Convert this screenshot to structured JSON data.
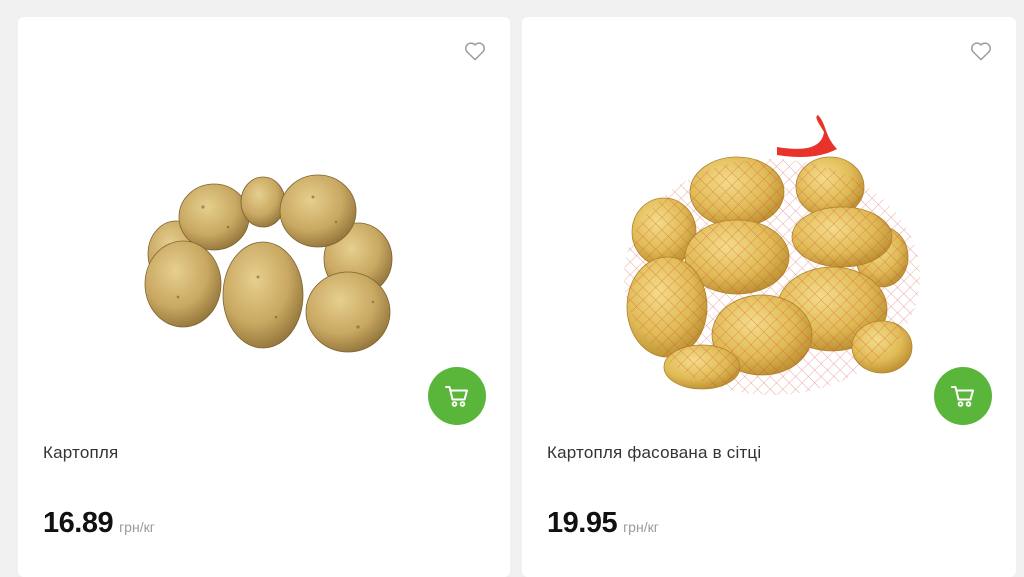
{
  "products": [
    {
      "name": "Картопля",
      "price": "16.89",
      "unit": "грн/кг",
      "image_icon": "potatoes-image",
      "favorite_icon": "heart-outline-icon",
      "cart_icon": "shopping-cart-icon"
    },
    {
      "name": "Картопля фасована в сітці",
      "price": "19.95",
      "unit": "грн/кг",
      "image_icon": "potatoes-in-net-bag-image",
      "favorite_icon": "heart-outline-icon",
      "cart_icon": "shopping-cart-icon"
    }
  ],
  "colors": {
    "accent": "#5ab63b",
    "background": "#f0f0f0",
    "card": "#ffffff",
    "price_text": "#111111",
    "unit_text": "#9a9a9a"
  }
}
